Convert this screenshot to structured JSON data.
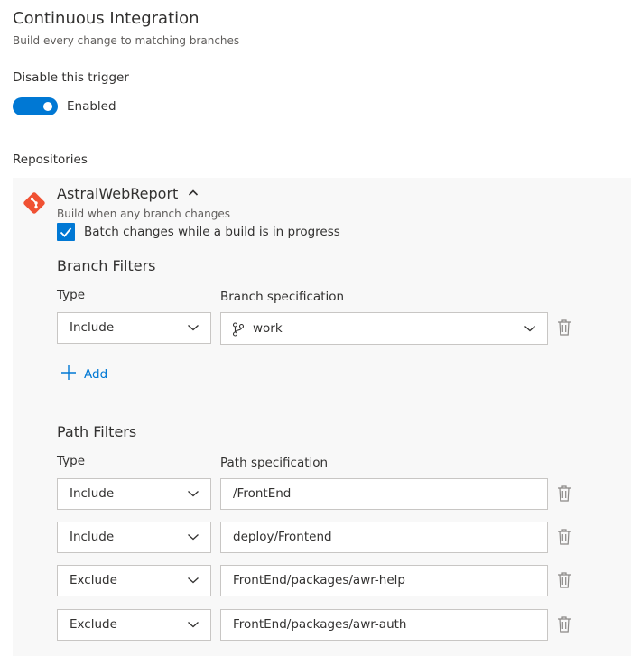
{
  "header": {
    "title": "Continuous Integration",
    "subtitle": "Build every change to matching branches"
  },
  "trigger": {
    "label": "Disable this trigger",
    "toggle_state": "Enabled",
    "enabled": true
  },
  "repositories": {
    "label": "Repositories",
    "repo": {
      "name": "AstralWebReport",
      "description": "Build when any branch changes",
      "batch_label": "Batch changes while a build is in progress",
      "batch_checked": true
    }
  },
  "branch_filters": {
    "title": "Branch Filters",
    "type_header": "Type",
    "spec_header": "Branch specification",
    "rows": [
      {
        "type": "Include",
        "spec": "work"
      }
    ],
    "add_label": "Add"
  },
  "path_filters": {
    "title": "Path Filters",
    "type_header": "Type",
    "spec_header": "Path specification",
    "rows": [
      {
        "type": "Include",
        "spec": "/FrontEnd"
      },
      {
        "type": "Include",
        "spec": "deploy/Frontend"
      },
      {
        "type": "Exclude",
        "spec": "FrontEnd/packages/awr-help"
      },
      {
        "type": "Exclude",
        "spec": "FrontEnd/packages/awr-auth"
      }
    ]
  },
  "colors": {
    "accent": "#0078d4",
    "git_icon": "#f05133",
    "panel_bg": "#f8f8f8",
    "border": "#c8c6c4"
  },
  "icons": {
    "repo": "git-icon",
    "collapse": "chevron-up-icon",
    "dropdown": "chevron-down-icon",
    "branch": "branch-icon",
    "delete": "trash-icon",
    "add": "plus-icon"
  }
}
